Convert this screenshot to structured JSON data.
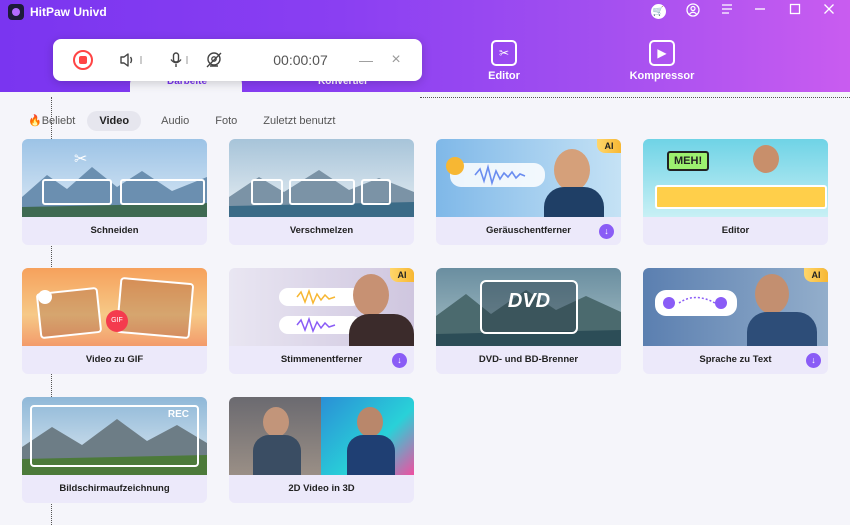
{
  "app": {
    "title": "HitPaw Univd"
  },
  "icons": {
    "cart": "cart-icon",
    "account": "account-icon",
    "menu": "menu-icon",
    "minimize": "minimize-icon",
    "maximize": "maximize-icon",
    "close": "close-icon"
  },
  "nav": {
    "tabs": [
      {
        "label": "Darbeite",
        "icon": "convert-icon"
      },
      {
        "label": "Konvertier",
        "icon": "convert-icon"
      },
      {
        "label": "Editor",
        "icon": "editor-icon"
      },
      {
        "label": "Kompressor",
        "icon": "compressor-icon"
      }
    ]
  },
  "recorder": {
    "timer": "00:00:07",
    "stop_icon": "stop-record-icon",
    "speaker_icon": "speaker-icon",
    "mic_icon": "microphone-icon",
    "camera_icon": "camera-off-icon",
    "minimize_label": "—",
    "close_label": "×"
  },
  "categories": [
    {
      "label": "🔥Beliebt"
    },
    {
      "label": "Video"
    },
    {
      "label": "Audio"
    },
    {
      "label": "Foto"
    },
    {
      "label": "Zuletzt benutzt"
    }
  ],
  "badges": {
    "ai": "AI",
    "download": "↓"
  },
  "cards": [
    {
      "label": "Schneiden"
    },
    {
      "label": "Verschmelzen"
    },
    {
      "label": "Geräuschentferner"
    },
    {
      "label": "Editor"
    },
    {
      "label": "Video zu GIF"
    },
    {
      "label": "Stimmenentferner"
    },
    {
      "label": "DVD- und BD-Brenner"
    },
    {
      "label": "Sprache zu Text"
    },
    {
      "label": "Bildschirmaufzeichnung"
    },
    {
      "label": "2D Video in 3D"
    }
  ],
  "thumb_text": {
    "meh": "MEH!",
    "gif": "GIF",
    "dvd": "DVD",
    "rec": "REC"
  },
  "colors": {
    "accent": "#8a3ff2",
    "record_red": "#ff4444",
    "ai_badge": "#f7b733",
    "download_badge": "#8a5cf6"
  }
}
